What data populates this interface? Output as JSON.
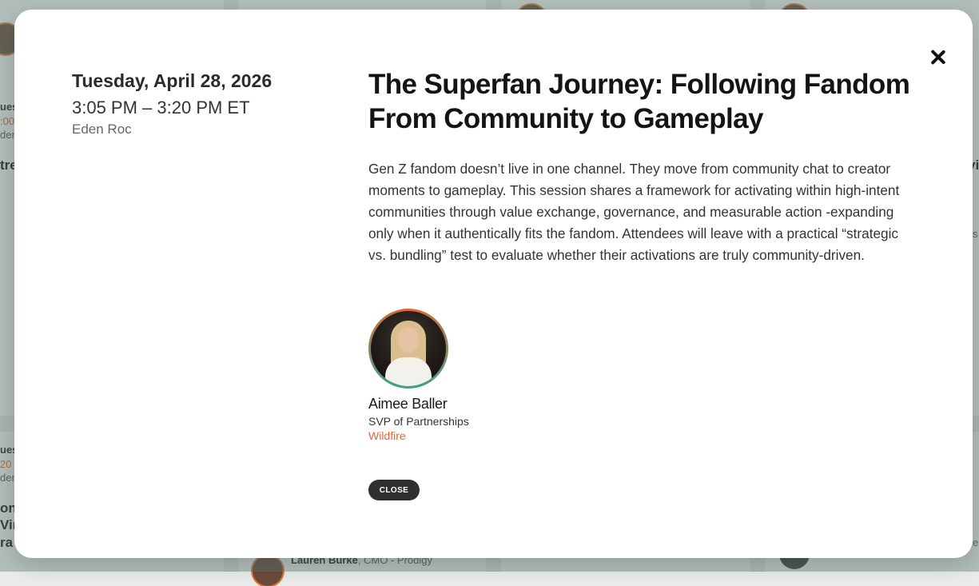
{
  "modal": {
    "date": "Tuesday, April 28, 2026",
    "time": "3:05 PM – 3:20 PM ET",
    "room": "Eden Roc",
    "title": "The Superfan Journey: Following Fandom From Community to Gameplay",
    "description": "Gen Z fandom doesn’t live in one channel. They move from community chat to creator moments to gameplay. This session shares a framework for activating within high-intent communities through value exchange, governance, and measurable action -expanding only when it authentically fits the fandom. Attendees will leave with a practical “strategic vs. bundling” test to evaluate whether their activations are truly community-driven.",
    "speaker": {
      "name": "Aimee Baller",
      "role": "SVP of Partnerships",
      "company": "Wildfire"
    },
    "close_label": "CLOSE",
    "close_icon": "close-icon"
  },
  "background": {
    "left_col": {
      "label_ues_1": "ues",
      "label_time_1": ":00",
      "label_room_1": "den",
      "label_title_1": "tre",
      "label_ues_2": "ues",
      "label_time_2": "20",
      "label_room_2": "den",
      "label_title_2a": "on",
      "label_title_2b": "Vin",
      "label_title_2c": "ra"
    },
    "bottom_speaker": {
      "name": "Lauren Burke",
      "title": ", CMO - Prodigy"
    },
    "right_fragments": {
      "vi": "vi",
      "s": "s",
      "e": "e"
    }
  },
  "colors": {
    "accent": "#e8642c",
    "teal": "#2aa79b",
    "button_dark": "#2f2f2f"
  }
}
